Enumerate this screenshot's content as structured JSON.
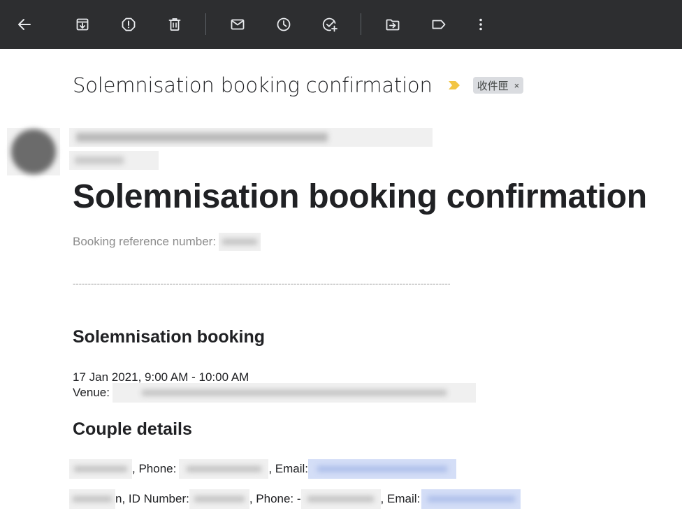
{
  "toolbar": {
    "buttons": [
      {
        "name": "back-arrow-icon"
      },
      {
        "name": "archive-icon"
      },
      {
        "name": "report-spam-icon"
      },
      {
        "name": "delete-icon"
      },
      {
        "name": "mark-unread-icon"
      },
      {
        "name": "snooze-icon"
      },
      {
        "name": "add-task-icon"
      },
      {
        "name": "move-to-icon"
      },
      {
        "name": "label-icon"
      },
      {
        "name": "more-vert-icon"
      }
    ],
    "background": "#2d2e30",
    "icon_color": "#e8eaed"
  },
  "email": {
    "subject": "Solemnisation booking confirmation",
    "label_chip": "收件匣",
    "label_remove": "×",
    "importance_color": "#f2c544"
  },
  "content": {
    "title": "Solemnisation booking confirmation",
    "booking_ref_label": "Booking reference number:",
    "divider": "------------------------------------------------------------------------------------------------------------------------------------",
    "booking_heading": "Solemnisation booking",
    "booking_datetime": "17 Jan 2021, 9:00 AM - 10:00 AM",
    "venue_label": "Venue:",
    "couple_heading": "Couple details",
    "row1": {
      "phone_label": ", Phone:",
      "email_label": ", Email:"
    },
    "row2": {
      "name_end": "n",
      "id_label": ", ID Number:",
      "phone_label": ", Phone: -",
      "email_label": ", Email:"
    }
  }
}
